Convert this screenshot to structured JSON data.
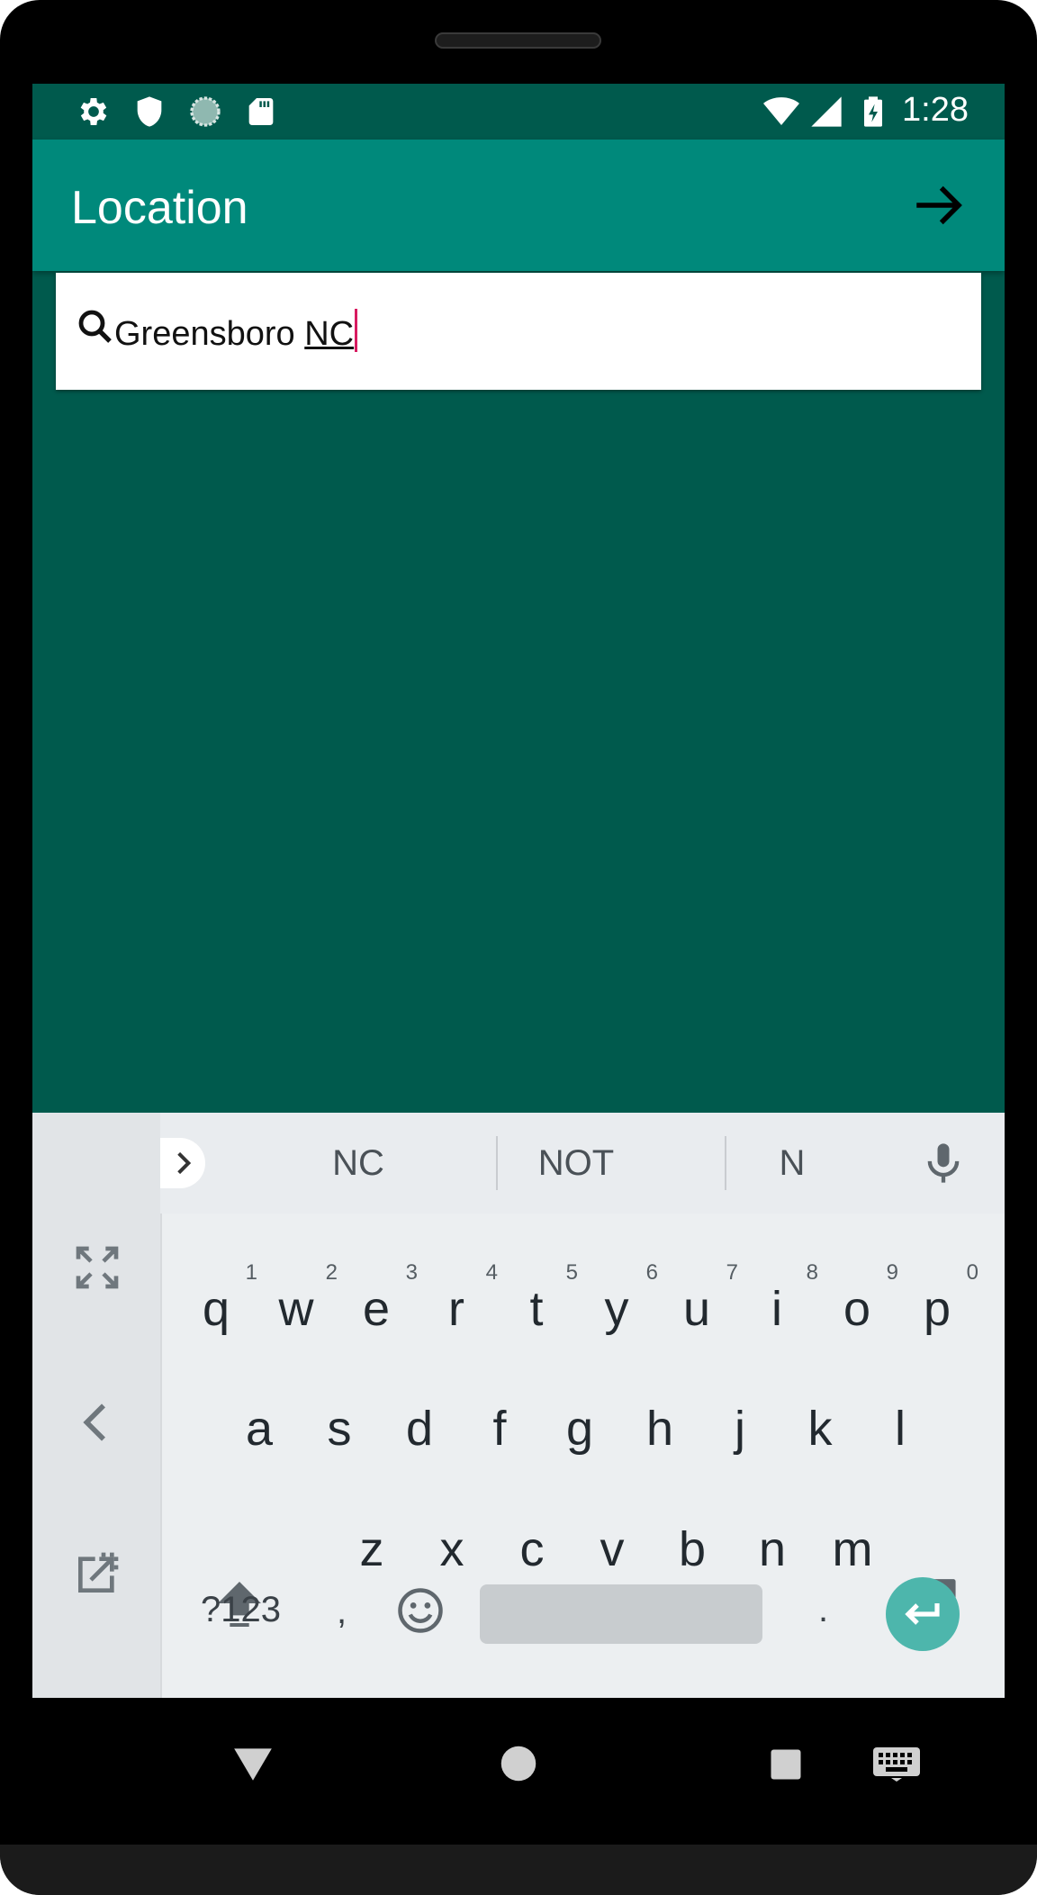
{
  "status_bar": {
    "time": "1:28",
    "left_icons": [
      "gear-icon",
      "shield-icon",
      "loading-icon",
      "sd-card-icon"
    ],
    "right_icons": [
      "wifi-icon",
      "signal-icon",
      "battery-charging-icon"
    ]
  },
  "app_bar": {
    "title": "Location",
    "action_icon": "arrow-right-icon",
    "color": "#00897b"
  },
  "search": {
    "text_committed": "Greensboro ",
    "text_composing": "NC"
  },
  "keyboard": {
    "suggestions": [
      "NC",
      "NOT",
      "N"
    ],
    "row1": [
      {
        "key": "q",
        "hint": "1"
      },
      {
        "key": "w",
        "hint": "2"
      },
      {
        "key": "e",
        "hint": "3"
      },
      {
        "key": "r",
        "hint": "4"
      },
      {
        "key": "t",
        "hint": "5"
      },
      {
        "key": "y",
        "hint": "6"
      },
      {
        "key": "u",
        "hint": "7"
      },
      {
        "key": "i",
        "hint": "8"
      },
      {
        "key": "o",
        "hint": "9"
      },
      {
        "key": "p",
        "hint": "0"
      }
    ],
    "row2": [
      "a",
      "s",
      "d",
      "f",
      "g",
      "h",
      "j",
      "k",
      "l"
    ],
    "row3": [
      "z",
      "x",
      "c",
      "v",
      "b",
      "n",
      "m"
    ],
    "symbols_label": "?123",
    "comma_label": ",",
    "period_label": ".",
    "accent_color": "#4db6ac"
  },
  "colors": {
    "background": "#005a4d",
    "caret": "#d81b60"
  }
}
